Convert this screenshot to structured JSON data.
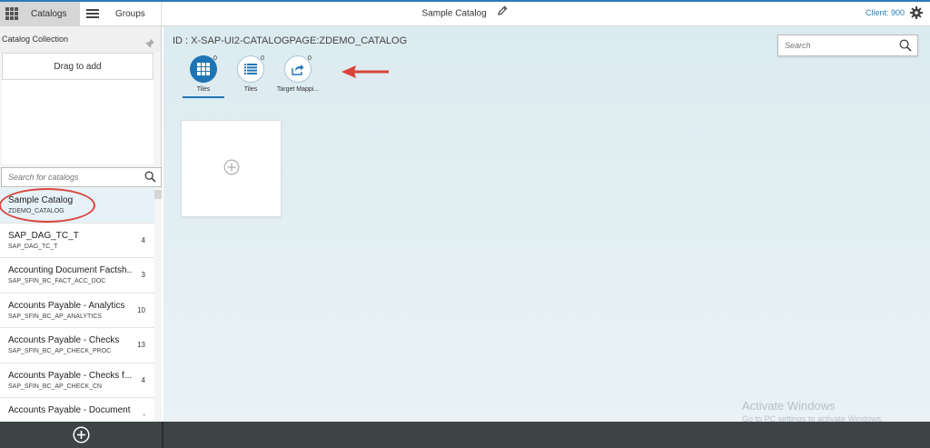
{
  "header": {
    "catalogs_label": "Catalogs",
    "groups_label": "Groups",
    "title": "Sample Catalog",
    "client": "Client: 900",
    "accent_color": "#2b7cb8"
  },
  "sidebar": {
    "collection_title": "Catalog Collection",
    "drag_label": "Drag to add",
    "search_placeholder": "Search for catalogs",
    "catalogs": [
      {
        "name": "Sample Catalog",
        "id": "ZDEMO_CATALOG",
        "count": ""
      },
      {
        "name": "SAP_DAG_TC_T",
        "id": "SAP_DAG_TC_T",
        "count": "4"
      },
      {
        "name": "Accounting Document Factsh...",
        "id": "SAP_SFIN_BC_FACT_ACC_DOC",
        "count": "3"
      },
      {
        "name": "Accounts Payable - Analytics",
        "id": "SAP_SFIN_BC_AP_ANALYTICS",
        "count": "10"
      },
      {
        "name": "Accounts Payable - Checks",
        "id": "SAP_SFIN_BC_AP_CHECK_PROC",
        "count": "13"
      },
      {
        "name": "Accounts Payable - Checks f...",
        "id": "SAP_SFIN_BC_AP_CHECK_CN",
        "count": "4"
      },
      {
        "name": "Accounts Payable - Document ...",
        "id": "",
        "count": "-"
      }
    ]
  },
  "main": {
    "catalog_id": "ID : X-SAP-UI2-CATALOGPAGE:ZDEMO_CATALOG",
    "search_placeholder": "Search",
    "tabs": [
      {
        "label": "Tiles",
        "count": "0",
        "icon": "grid-icon",
        "active": true
      },
      {
        "label": "Tiles",
        "count": "0",
        "icon": "list-icon",
        "active": false
      },
      {
        "label": "Target Mappi...",
        "count": "0",
        "icon": "share-icon",
        "active": false
      }
    ]
  },
  "watermark": {
    "line1": "Activate Windows",
    "line2": "Go to PC settings to activate Windows."
  }
}
